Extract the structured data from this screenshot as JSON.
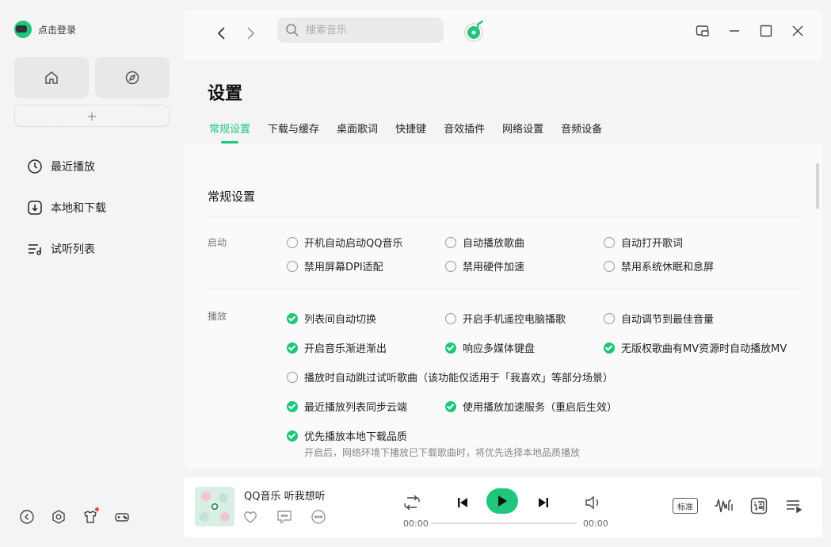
{
  "sidebar": {
    "login_text": "点击登录",
    "add_label": "+",
    "nav": [
      {
        "label": "最近播放",
        "icon": "clock-icon"
      },
      {
        "label": "本地和下载",
        "icon": "download-icon"
      },
      {
        "label": "试听列表",
        "icon": "playlist-icon"
      }
    ]
  },
  "topbar": {
    "search_placeholder": "搜索音乐"
  },
  "page": {
    "title": "设置",
    "tabs": [
      "常规设置",
      "下载与缓存",
      "桌面歌词",
      "快捷键",
      "音效插件",
      "网络设置",
      "音频设备"
    ],
    "active_tab": 0
  },
  "settings": {
    "section_title": "常规设置",
    "startup_label": "启动",
    "startup": [
      {
        "label": "开机自动启动QQ音乐",
        "checked": false
      },
      {
        "label": "自动播放歌曲",
        "checked": false
      },
      {
        "label": "自动打开歌词",
        "checked": false
      },
      {
        "label": "禁用屏幕DPI适配",
        "checked": false
      },
      {
        "label": "禁用硬件加速",
        "checked": false
      },
      {
        "label": "禁用系统休眠和息屏",
        "checked": false
      }
    ],
    "playback_label": "播放",
    "playback": [
      {
        "label": "列表间自动切换",
        "checked": true
      },
      {
        "label": "开启手机遥控电脑播歌",
        "checked": false
      },
      {
        "label": "自动调节到最佳音量",
        "checked": false
      },
      {
        "label": "开启音乐渐进渐出",
        "checked": true
      },
      {
        "label": "响应多媒体键盘",
        "checked": true
      },
      {
        "label": "无版权歌曲有MV资源时自动播放MV",
        "checked": true
      },
      {
        "label": "播放时自动跳过试听歌曲（该功能仅适用于「我喜欢」等部分场景）",
        "checked": false
      },
      {
        "label": "最近播放列表同步云端",
        "checked": true
      },
      {
        "label": "使用播放加速服务（重启后生效）",
        "checked": true
      },
      {
        "label": "优先播放本地下载品质",
        "checked": true
      }
    ],
    "hint": "开启后，网络环境下播放已下载歌曲时，将优先选择本地品质播放"
  },
  "player": {
    "song_title": "QQ音乐 听我想听",
    "time_current": "00:00",
    "time_total": "00:00",
    "quality": "标准",
    "progress": 0
  },
  "colors": {
    "accent": "#1ec77b"
  }
}
